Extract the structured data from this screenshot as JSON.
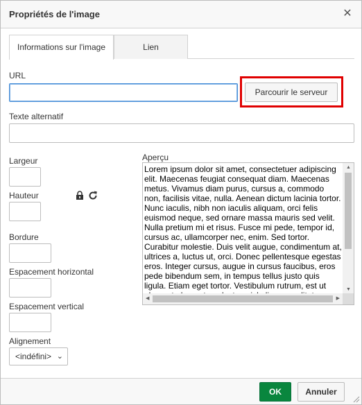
{
  "dialog": {
    "title": "Propriétés de l'image",
    "close_symbol": "✕"
  },
  "tabs": [
    {
      "label": "Informations sur l'image",
      "active": true
    },
    {
      "label": "Lien",
      "active": false
    }
  ],
  "url": {
    "label": "URL",
    "value": "",
    "browse_label": "Parcourir le serveur"
  },
  "alt": {
    "label": "Texte alternatif",
    "value": ""
  },
  "width": {
    "label": "Largeur",
    "value": ""
  },
  "height": {
    "label": "Hauteur",
    "value": ""
  },
  "border": {
    "label": "Bordure",
    "value": ""
  },
  "hspace": {
    "label": "Espacement horizontal",
    "value": ""
  },
  "vspace": {
    "label": "Espacement vertical",
    "value": ""
  },
  "align": {
    "label": "Alignement",
    "selected": "<indéfini>"
  },
  "preview": {
    "label": "Aperçu",
    "text": "Lorem ipsum dolor sit amet, consectetuer adipiscing elit. Maecenas feugiat consequat diam. Maecenas metus. Vivamus diam purus, cursus a, commodo non, facilisis vitae, nulla. Aenean dictum lacinia tortor. Nunc iaculis, nibh non iaculis aliquam, orci felis euismod neque, sed ornare massa mauris sed velit. Nulla pretium mi et risus. Fusce mi pede, tempor id, cursus ac, ullamcorper nec, enim. Sed tortor. Curabitur molestie. Duis velit augue, condimentum at, ultrices a, luctus ut, orci. Donec pellentesque egestas eros. Integer cursus, augue in cursus faucibus, eros pede bibendum sem, in tempus tellus justo quis ligula. Etiam eget tortor. Vestibulum rutrum, est ut placerat elementum, lectus nisl aliquam velit, tempor aliquam eros nunc nonummy metus."
  },
  "footer": {
    "ok_label": "OK",
    "cancel_label": "Annuler"
  },
  "colors": {
    "ok_green": "#09863e",
    "highlight_red": "#e00000",
    "focus_blue": "#4a90d9"
  }
}
